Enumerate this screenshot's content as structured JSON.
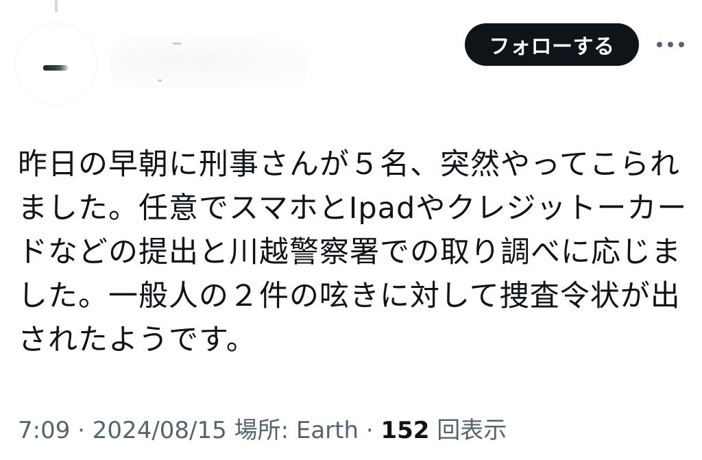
{
  "tweet": {
    "lines": [
      "昨日の早朝に刑事さんが５名、突然やってこられ",
      "ました。任意でスマホとIpadやクレジットーカー",
      "ドなどの提出と川越警察署での取り調べに応じま",
      "した。一般人の２件の呟きに対して捜査令状が出",
      "されたようです。"
    ]
  },
  "header": {
    "follow_label": "フォローする",
    "more_icon": "more-horizontal-icon"
  },
  "meta": {
    "time": "7:09",
    "sep1": " · ",
    "date": "2024/08/15",
    "location": "場所: Earth",
    "sep2": " · ",
    "views_count": "152",
    "views_label": "回表示"
  },
  "colors": {
    "text": "#0f1419",
    "secondary": "#536471",
    "button_bg": "#0f1419",
    "button_text": "#ffffff"
  }
}
